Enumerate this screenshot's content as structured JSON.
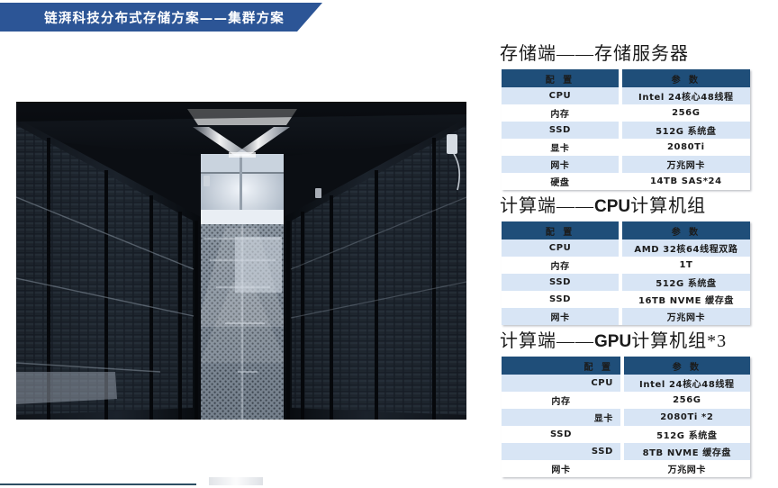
{
  "banner": {
    "title": "链湃科技分布式存储方案——集群方案",
    "color": "#2c5596"
  },
  "photo": {
    "alt": "data-center-corridor-photo",
    "caption": ""
  },
  "colors": {
    "header_navy": "#1f4e79",
    "row_light_blue": "#d8e5f5",
    "row_white": "#ffffff",
    "banner_blue": "#2c5596",
    "rule": "#2d4e63"
  },
  "sections": [
    {
      "title_cjk_1": "存储端——",
      "title_latin": "",
      "title_cjk_2": "存储服务器",
      "title_full": "存储端——存储服务器",
      "headers": [
        "配 置",
        "参 数"
      ],
      "rows": [
        {
          "key": "CPU",
          "value": "Intel 24核心48线程"
        },
        {
          "key": "内存",
          "value": "256G"
        },
        {
          "key": "SSD",
          "value": "512G 系统盘"
        },
        {
          "key": "显卡",
          "value": "2080Ti"
        },
        {
          "key": "网卡",
          "value": "万兆网卡"
        },
        {
          "key": "硬盘",
          "value": "14TB SAS*24"
        }
      ]
    },
    {
      "title_cjk_1": "计算端——",
      "title_latin": "CPU",
      "title_cjk_2": "计算机组",
      "title_full": "计算端——CPU计算机组",
      "headers": [
        "配 置",
        "参 数"
      ],
      "rows": [
        {
          "key": "CPU",
          "value": "AMD 32核64线程双路"
        },
        {
          "key": "内存",
          "value": "1T"
        },
        {
          "key": "SSD",
          "value": "512G 系统盘"
        },
        {
          "key": "SSD",
          "value": "16TB NVME 缓存盘"
        },
        {
          "key": "网卡",
          "value": "万兆网卡"
        }
      ]
    },
    {
      "title_cjk_1": "计算端——",
      "title_latin": "GPU",
      "title_cjk_2": "计算机组*3",
      "title_full": "计算端——GPU计算机组*3",
      "headers": [
        "配 置",
        "参 数"
      ],
      "rows": [
        {
          "key": "CPU",
          "value": "Intel 24核心48线程"
        },
        {
          "key": "内存",
          "value": "256G"
        },
        {
          "key": "显卡",
          "value": "2080Ti *2"
        },
        {
          "key": "SSD",
          "value": "512G 系统盘"
        },
        {
          "key": "SSD",
          "value": "8TB NVME 缓存盘"
        },
        {
          "key": "网卡",
          "value": "万兆网卡"
        }
      ]
    }
  ]
}
